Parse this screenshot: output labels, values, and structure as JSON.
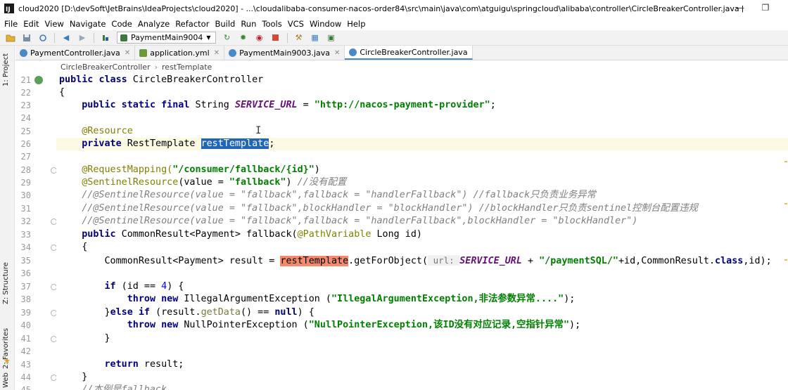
{
  "window": {
    "title": "cloud2020 [D:\\devSoft\\JetBrains\\IdeaProjects\\cloud2020] - ...\\cloudalibaba-consumer-nacos-order84\\src\\main\\java\\com\\atguigu\\springcloud\\alibaba\\controller\\CircleBreakerController.java [cloudalibaba-c...",
    "icon_letter": "IJ",
    "minimize": "—",
    "maximize": "❐"
  },
  "menu": [
    "File",
    "Edit",
    "View",
    "Navigate",
    "Code",
    "Analyze",
    "Refactor",
    "Build",
    "Run",
    "Tools",
    "VCS",
    "Window",
    "Help"
  ],
  "toolbar": {
    "run_config": "PaymentMain9004",
    "icons": [
      "folder-icon",
      "save-icon",
      "sync-icon",
      "back-icon",
      "forward-icon",
      "build-icon",
      "run-config",
      "run-icon",
      "debug-icon",
      "coverage-icon",
      "stop-icon",
      "settings-icon",
      "project-structure-icon",
      "terminal-icon"
    ]
  },
  "side_strip": {
    "project": "1: Project",
    "structure": "Z: Structure",
    "favorites": "2: Favorites",
    "web": "Web"
  },
  "tabs": [
    {
      "label": "PaymentController.java",
      "color": "#4a88c7",
      "active": false
    },
    {
      "label": "application.yml",
      "color": "#6a9a3a",
      "active": false
    },
    {
      "label": "PaymentMain9003.java",
      "color": "#4a88c7",
      "active": false
    },
    {
      "label": "CircleBreakerController.java",
      "color": "#4a88c7",
      "active": true
    }
  ],
  "breadcrumb": [
    "CircleBreakerController",
    "restTemplate"
  ],
  "code": {
    "line_numbers": [
      "21",
      "22",
      "23",
      "24",
      "25",
      "26",
      "27",
      "28",
      "29",
      "30",
      "31",
      "32",
      "33",
      "34",
      "35",
      "36",
      "37",
      "38",
      "39",
      "40",
      "41",
      "42",
      "43",
      "44",
      "45"
    ],
    "l21": {
      "kw1": "public",
      "kw2": "class",
      "name": " CircleBreakerController"
    },
    "l22": "{",
    "l23": {
      "kw": "public static final",
      "type": " String ",
      "const": "SERVICE_URL",
      "eq": " = ",
      "str": "\"http://nacos-payment-provider\"",
      "end": ";"
    },
    "l25": "@Resource",
    "l26": {
      "kw": "private",
      "type": " RestTemplate ",
      "sel": "restTemplate",
      "end": ";"
    },
    "l28": {
      "ann": "@RequestMapping(",
      "str": "\"/consumer/fallback/{id}\"",
      "end": ")"
    },
    "l29": {
      "ann": "@SentinelResource",
      "mid": "(value = ",
      "str": "\"fallback\"",
      "end": ") ",
      "cmt": "//没有配置"
    },
    "l30": "//@SentinelResource(value = \"fallback\",fallback = \"handlerFallback\") //fallback只负责业务异常",
    "l31": "//@SentinelResource(value = \"fallback\",blockHandler = \"blockHandler\") //blockHandler只负责sentinel控制台配置违规",
    "l32": "//@SentinelResource(value = \"fallback\",fallback = \"handlerFallback\",blockHandler = \"blockHandler\")",
    "l33": {
      "kw": "public",
      "sig1": " CommonResult<Payment> fallback(",
      "ann": "@PathVariable",
      "sig2": " Long id)"
    },
    "l34": "{",
    "l35": {
      "pre": "CommonResult<Payment> result = ",
      "warn": "restTemplate",
      "call": ".getForObject(",
      "hint": " url: ",
      "const": "SERVICE_URL",
      "plus": " + ",
      "str": "\"/paymentSQL/\"",
      "rest": "+id,CommonResult.",
      "kw": "class",
      "end": ",id);"
    },
    "l37": {
      "kw": "if",
      "cond": " (id == ",
      "num": "4",
      "end": ") {"
    },
    "l38": {
      "kw": "throw new",
      "cls": " IllegalArgumentException (",
      "str": "\"IllegalArgumentException,非法参数异常....\"",
      "end": ");"
    },
    "l39": {
      "pre": "}",
      "kw": "else if",
      "mid": " (result.",
      "method": "getData",
      "mid2": "() == ",
      "kw2": "null",
      "end": ") {"
    },
    "l40": {
      "kw": "throw new",
      "cls": " NullPointerException (",
      "str": "\"NullPointerException,该ID没有对应记录,空指针异常\"",
      "end": ");"
    },
    "l41": "}",
    "l43": {
      "kw": "return",
      "end": " result;"
    },
    "l44": "}",
    "l45": "//本例是fallback"
  }
}
